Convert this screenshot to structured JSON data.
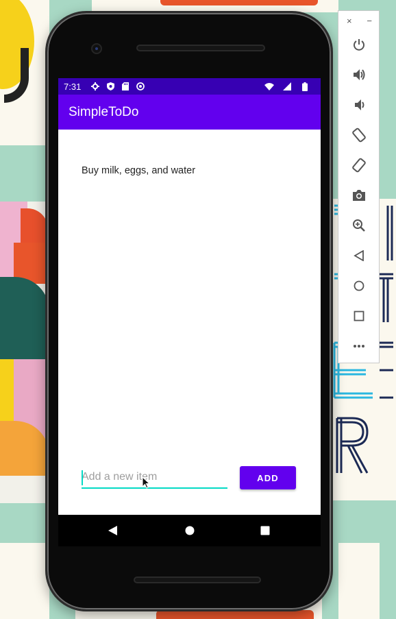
{
  "status_bar": {
    "time": "7:31"
  },
  "app": {
    "title": "SimpleToDo"
  },
  "items": [
    {
      "text": "Buy milk, eggs, and water"
    }
  ],
  "composer": {
    "placeholder": "Add a new item",
    "add_label": "ADD"
  },
  "emulator": {
    "close_label": "×",
    "minimize_label": "−"
  },
  "colors": {
    "status_bar": "#3700b3",
    "app_bar": "#6200ee",
    "accent": "#03dac5",
    "button": "#6200ee"
  }
}
